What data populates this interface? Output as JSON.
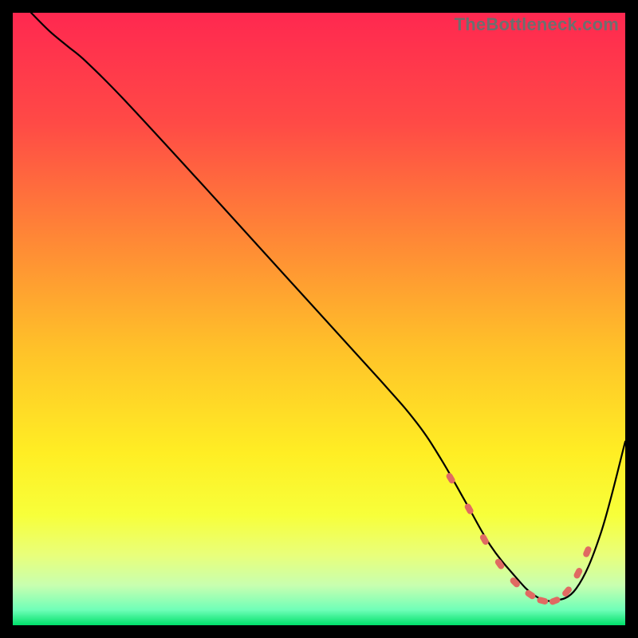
{
  "watermark": "TheBottleneck.com",
  "chart_data": {
    "type": "line",
    "title": "",
    "xlabel": "",
    "ylabel": "",
    "xlim": [
      0,
      100
    ],
    "ylim": [
      0,
      100
    ],
    "grid": false,
    "legend": false,
    "background_gradient": {
      "stops": [
        {
          "offset": 0.0,
          "color": "#ff2850"
        },
        {
          "offset": 0.18,
          "color": "#ff4a46"
        },
        {
          "offset": 0.38,
          "color": "#ff8b35"
        },
        {
          "offset": 0.55,
          "color": "#ffc229"
        },
        {
          "offset": 0.72,
          "color": "#ffee24"
        },
        {
          "offset": 0.82,
          "color": "#f7ff3a"
        },
        {
          "offset": 0.885,
          "color": "#e9ff7a"
        },
        {
          "offset": 0.935,
          "color": "#c8ffb0"
        },
        {
          "offset": 0.975,
          "color": "#6fffb8"
        },
        {
          "offset": 1.0,
          "color": "#00e06a"
        }
      ]
    },
    "series": [
      {
        "name": "curve",
        "color": "#000000",
        "x": [
          3,
          6,
          9,
          12,
          18,
          30,
          45,
          60,
          66,
          70,
          74,
          78,
          82,
          85,
          88,
          92,
          96,
          100
        ],
        "y": [
          100,
          97,
          94.5,
          92,
          86,
          73,
          56.5,
          40,
          33,
          27,
          20,
          13,
          8,
          5,
          4,
          6,
          15,
          30
        ]
      }
    ],
    "markers": {
      "name": "valley-dots",
      "color": "#e06a62",
      "shape": "capsule",
      "x": [
        71.5,
        74.5,
        77,
        79.5,
        82,
        84.5,
        86.5,
        88.5,
        90.5,
        92.3,
        93.8
      ],
      "y": [
        24,
        19,
        14,
        10,
        7,
        5,
        4,
        4,
        5.5,
        8.5,
        12
      ]
    }
  }
}
